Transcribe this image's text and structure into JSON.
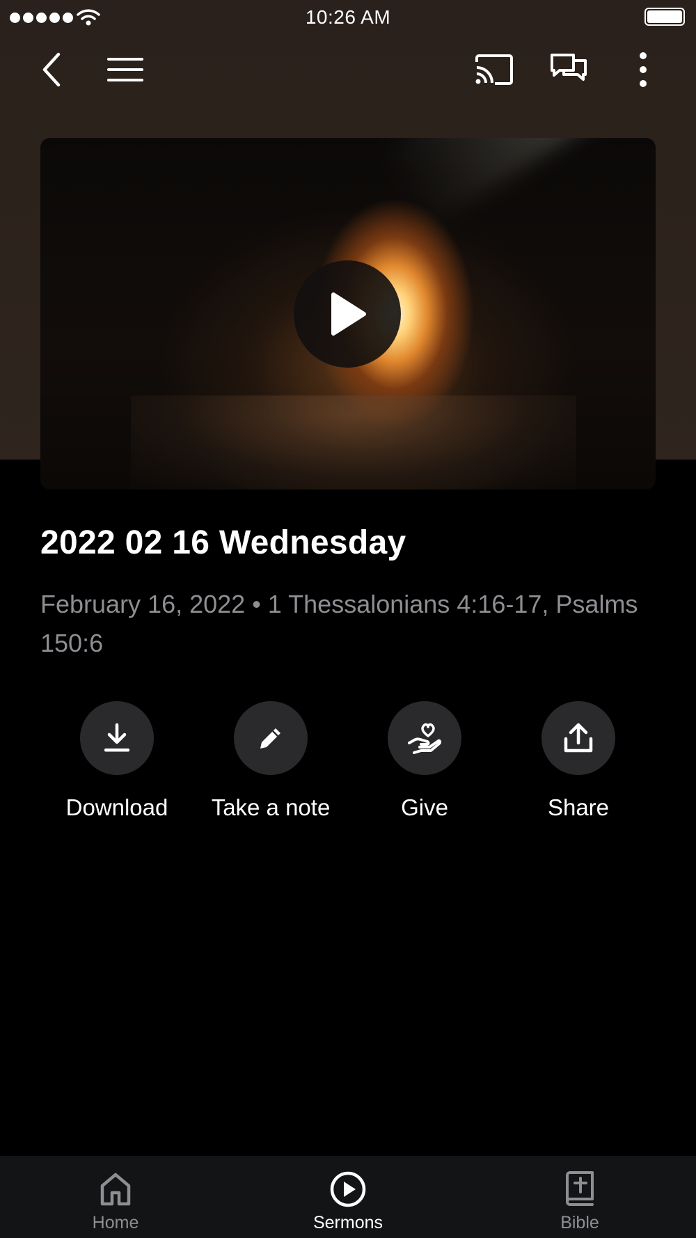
{
  "status_bar": {
    "time": "10:26 AM"
  },
  "top_bar": {
    "back_icon": "chevron-left-icon",
    "menu_icon": "hamburger-menu-icon",
    "cast_icon": "cast-icon",
    "chat_icon": "chat-bubbles-icon",
    "more_icon": "more-vertical-icon"
  },
  "sermon": {
    "title": "2022 02 16 Wednesday",
    "meta": "February 16, 2022 • 1 Thessalonians 4:16-17, Psalms 150:6"
  },
  "actions": [
    {
      "label": "Download",
      "icon": "download-icon"
    },
    {
      "label": "Take a note",
      "icon": "pencil-icon"
    },
    {
      "label": "Give",
      "icon": "heart-hand-icon"
    },
    {
      "label": "Share",
      "icon": "share-icon"
    }
  ],
  "bottom_nav": [
    {
      "label": "Home",
      "icon": "home-icon",
      "active": false
    },
    {
      "label": "Sermons",
      "icon": "play-circle-icon",
      "active": true
    },
    {
      "label": "Bible",
      "icon": "bible-icon",
      "active": false
    }
  ],
  "colors": {
    "background": "#000000",
    "header_bg": "#2c221c",
    "muted_text": "#8e8e93",
    "action_circle": "#2a2a2c",
    "nav_bg": "#131416"
  }
}
